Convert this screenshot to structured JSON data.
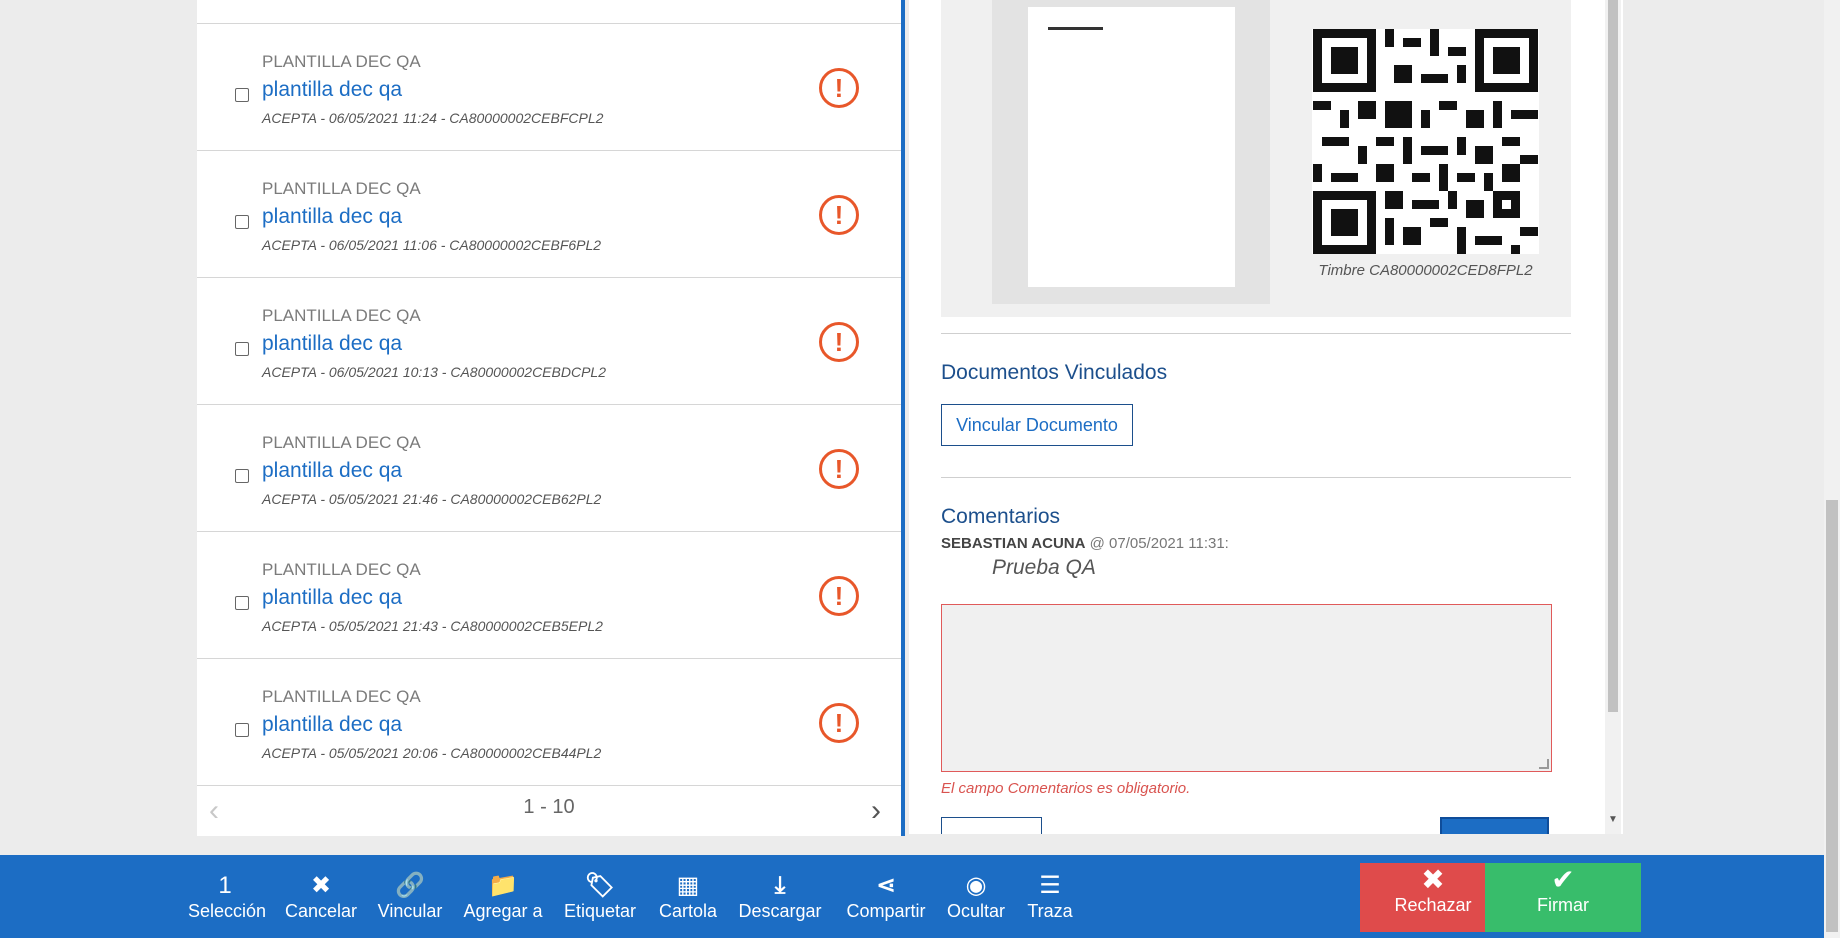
{
  "list": {
    "items": [
      {
        "category": "PLANTILLA DEC QA",
        "title": "plantilla dec qa",
        "meta": "ACEPTA - 06/05/2021 11:24 - CA80000002CEBFCPL2"
      },
      {
        "category": "PLANTILLA DEC QA",
        "title": "plantilla dec qa",
        "meta": "ACEPTA - 06/05/2021 11:06 - CA80000002CEBF6PL2"
      },
      {
        "category": "PLANTILLA DEC QA",
        "title": "plantilla dec qa",
        "meta": "ACEPTA - 06/05/2021 10:13 - CA80000002CEBDCPL2"
      },
      {
        "category": "PLANTILLA DEC QA",
        "title": "plantilla dec qa",
        "meta": "ACEPTA - 05/05/2021 21:46 - CA80000002CEB62PL2"
      },
      {
        "category": "PLANTILLA DEC QA",
        "title": "plantilla dec qa",
        "meta": "ACEPTA - 05/05/2021 21:43 - CA80000002CEB5EPL2"
      },
      {
        "category": "PLANTILLA DEC QA",
        "title": "plantilla dec qa",
        "meta": "ACEPTA - 05/05/2021 20:06 - CA80000002CEB44PL2"
      }
    ],
    "pager": {
      "range": "1 - 10"
    }
  },
  "detail": {
    "stamp_caption": "Timbre CA80000002CED8FPL2",
    "linked_docs": {
      "title": "Documentos Vinculados",
      "button": "Vincular Documento"
    },
    "comments": {
      "title": "Comentarios",
      "author": "SEBASTIAN ACUNA",
      "date": "@ 07/05/2021 11:31:",
      "text": "Prueba QA",
      "error": "El campo Comentarios es obligatorio."
    }
  },
  "toolbar": {
    "selection_count": "1",
    "tools": [
      {
        "icon": "x-icon",
        "glyph": "✖",
        "label": "Cancelar"
      },
      {
        "icon": "link-icon",
        "glyph": "🔗",
        "label": "Vincular"
      },
      {
        "icon": "folder-icon",
        "glyph": "📁",
        "label": "Agregar a"
      },
      {
        "icon": "tag-icon",
        "glyph": "🏷",
        "label": "Etiquetar"
      },
      {
        "icon": "table-icon",
        "glyph": "▦",
        "label": "Cartola"
      },
      {
        "icon": "download-icon",
        "glyph": "⤓",
        "label": "Descargar"
      },
      {
        "icon": "share-icon",
        "glyph": "⋖",
        "label": "Compartir"
      },
      {
        "icon": "eye-slash-icon",
        "glyph": "◉",
        "label": "Ocultar"
      },
      {
        "icon": "list-icon",
        "glyph": "☰",
        "label": "Traza"
      }
    ],
    "selection_label": "Selección",
    "reject_label": "Rechazar",
    "sign_label": "Firmar"
  },
  "colors": {
    "accent": "#1c6dc4",
    "warning": "#e8572a",
    "reject": "#df4b4b",
    "sign": "#38bd6b"
  }
}
